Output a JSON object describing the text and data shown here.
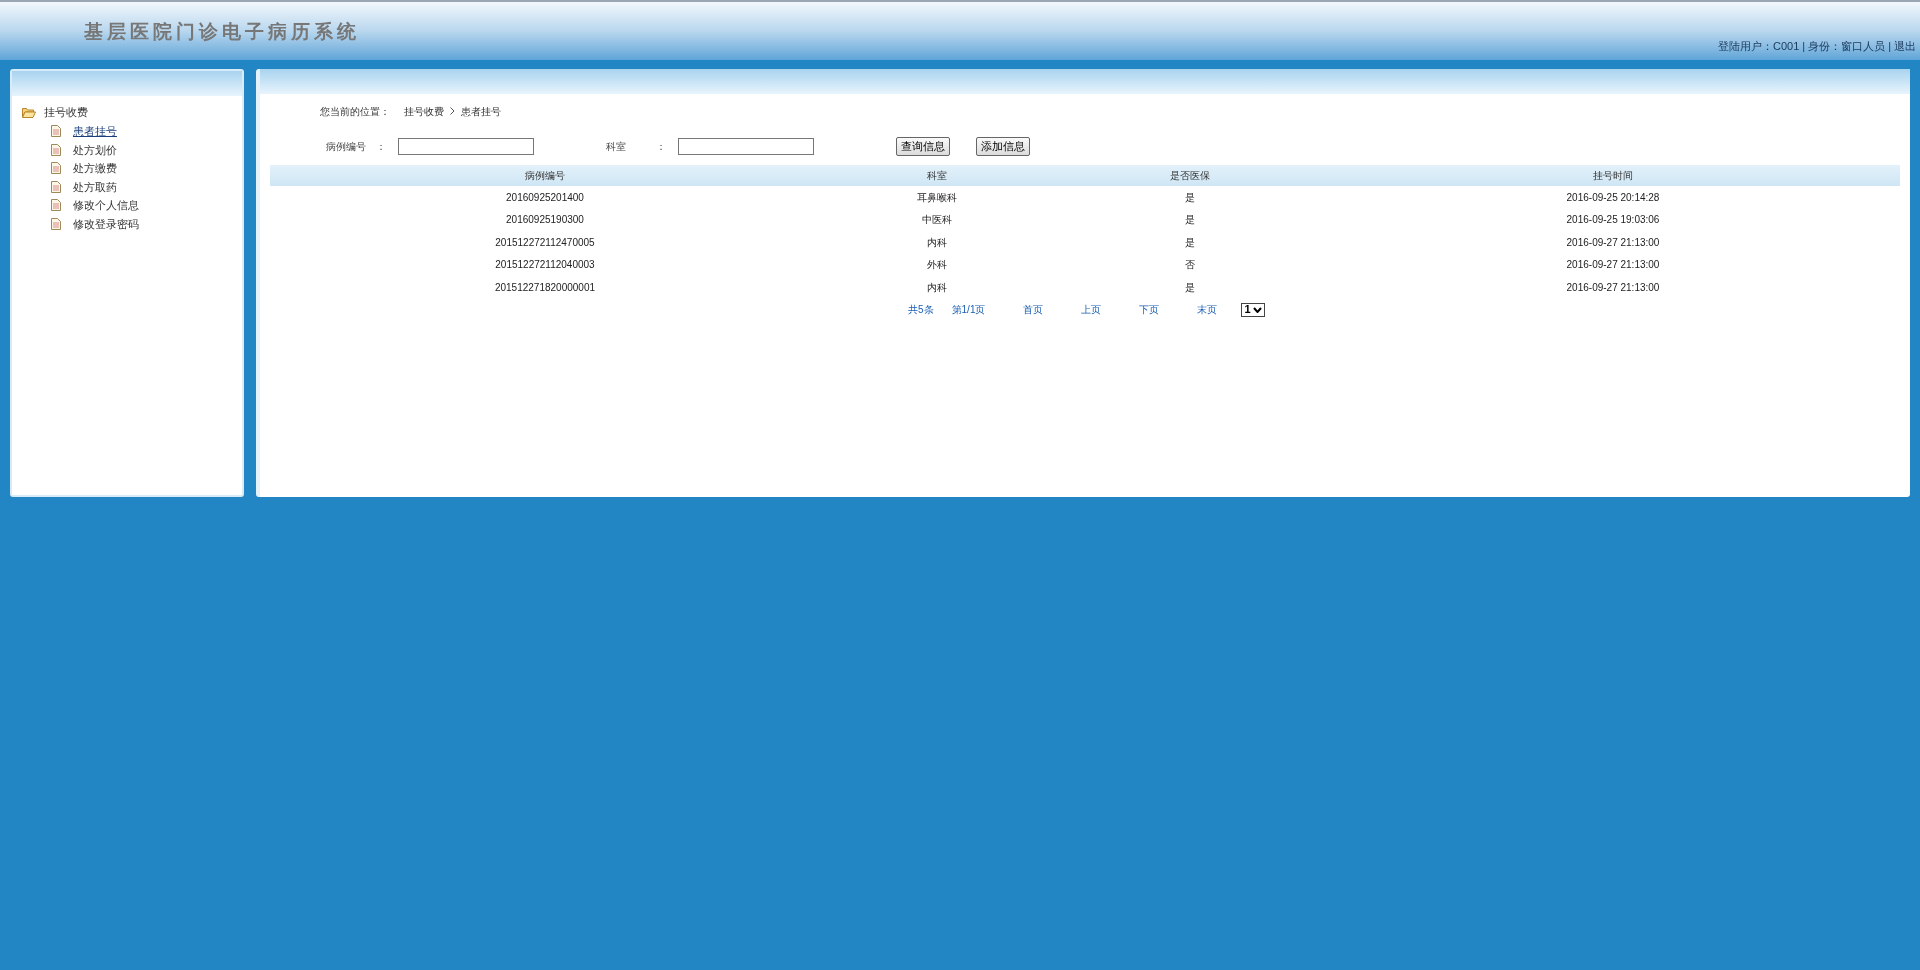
{
  "header": {
    "title": "基层医院门诊电子病历系统",
    "user_label": "登陆用户：C001",
    "role_label": "身份：窗口人员",
    "logout": "退出",
    "separators": [
      "|",
      "|"
    ]
  },
  "sidebar": {
    "group": {
      "label": "挂号收费",
      "expanded": true,
      "children": [
        {
          "label": "患者挂号",
          "selected": true
        },
        {
          "label": "处方划价",
          "selected": false
        },
        {
          "label": "处方缴费",
          "selected": false
        },
        {
          "label": "处方取药",
          "selected": false
        },
        {
          "label": "修改个人信息",
          "selected": false
        },
        {
          "label": "修改登录密码",
          "selected": false
        }
      ]
    }
  },
  "breadcrumb": {
    "prefix": "您当前的位置：",
    "items": [
      "挂号收费",
      "患者挂号"
    ]
  },
  "search": {
    "fields": [
      {
        "label": "病例编号",
        "colon": "："
      },
      {
        "label": "科室",
        "colon": "："
      }
    ],
    "buttons": [
      "查询信息",
      "添加信息"
    ]
  },
  "table": {
    "columns": [
      "病例编号",
      "科室",
      "是否医保",
      "挂号时间"
    ],
    "rows": [
      [
        "20160925201400",
        "耳鼻喉科",
        "是",
        "2016-09-25 20:14:28"
      ],
      [
        "20160925190300",
        "中医科",
        "是",
        "2016-09-25 19:03:06"
      ],
      [
        "201512272112470005",
        "内科",
        "是",
        "2016-09-27 21:13:00"
      ],
      [
        "201512272112040003",
        "外科",
        "否",
        "2016-09-27 21:13:00"
      ],
      [
        "201512271820000001",
        "内科",
        "是",
        "2016-09-27 21:13:00"
      ]
    ]
  },
  "pagination": {
    "total": "共5条",
    "page": "第1/1页",
    "links": [
      "首页",
      "上页",
      "下页",
      "末页"
    ],
    "page_select": "1"
  }
}
